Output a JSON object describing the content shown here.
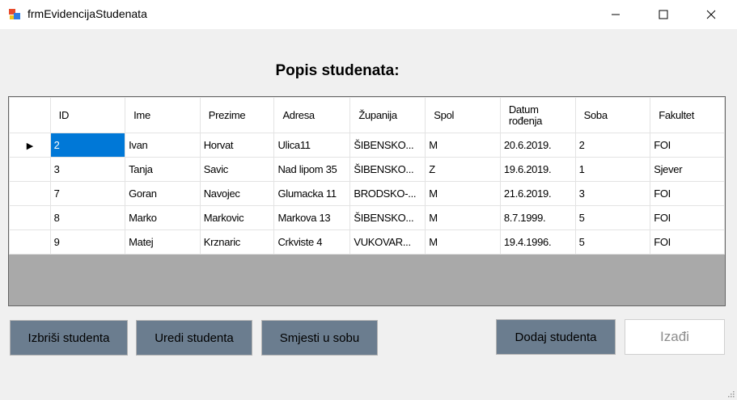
{
  "window": {
    "title": "frmEvidencijaStudenata",
    "minimize_glyph": "—",
    "maximize_glyph": "☐",
    "close_glyph": "✕"
  },
  "heading": "Popis studenata:",
  "table": {
    "columns": [
      "ID",
      "Ime",
      "Prezime",
      "Adresa",
      "Županija",
      "Spol",
      "Datum\nrođenja",
      "Soba",
      "Fakultet"
    ],
    "rows": [
      [
        "2",
        "Ivan",
        "Horvat",
        "Ulica11",
        "ŠIBENSKO...",
        "M",
        "20.6.2019.",
        "2",
        "FOI"
      ],
      [
        "3",
        "Tanja",
        "Savic",
        "Nad lipom 35",
        "ŠIBENSKO...",
        "Z",
        "19.6.2019.",
        "1",
        "Sjever"
      ],
      [
        "7",
        "Goran",
        "Navojec",
        "Glumacka 11",
        "BRODSKO-...",
        "M",
        "21.6.2019.",
        "3",
        "FOI"
      ],
      [
        "8",
        "Marko",
        "Markovic",
        "Markova 13",
        "ŠIBENSKO...",
        "M",
        "8.7.1999.",
        "5",
        "FOI"
      ],
      [
        "9",
        "Matej",
        "Krznaric",
        "Crkviste 4",
        "VUKOVAR...",
        "M",
        "19.4.1996.",
        "5",
        "FOI"
      ]
    ],
    "current_row_indicator": "▶"
  },
  "buttons": {
    "izbrisi": "Izbriši studenta",
    "uredi": "Uredi studenta",
    "smjesti": "Smjesti u sobu",
    "dodaj": "Dodaj studenta",
    "izadi": "Izađi"
  },
  "colors": {
    "button_bg": "#6b7d8f",
    "selection": "#0078d7",
    "grid_background": "#a9a9a9"
  }
}
